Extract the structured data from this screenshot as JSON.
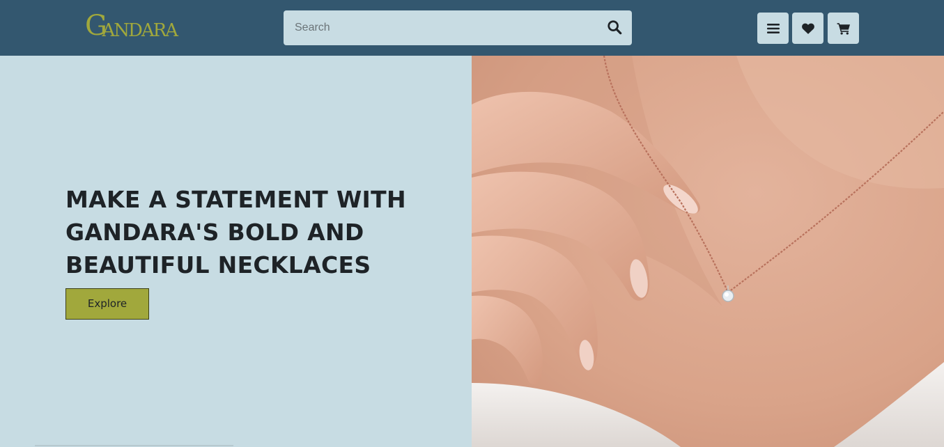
{
  "header": {
    "logo_text": "GANDARA",
    "logo_first": "G",
    "logo_rest": "ANDARA",
    "search": {
      "placeholder": "Search",
      "value": ""
    },
    "icons": {
      "search": "search-icon",
      "menu": "menu-icon",
      "heart": "heart-icon",
      "cart": "cart-icon"
    }
  },
  "hero": {
    "title": "MAKE A STATEMENT WITH GANDARA'S BOLD AND BEAUTIFUL NECKLACES",
    "button_label": "Explore"
  },
  "colors": {
    "header_bg": "#33576f",
    "hero_bg": "#c7dce3",
    "accent": "#a1a83c",
    "text_dark": "#1e2327"
  }
}
